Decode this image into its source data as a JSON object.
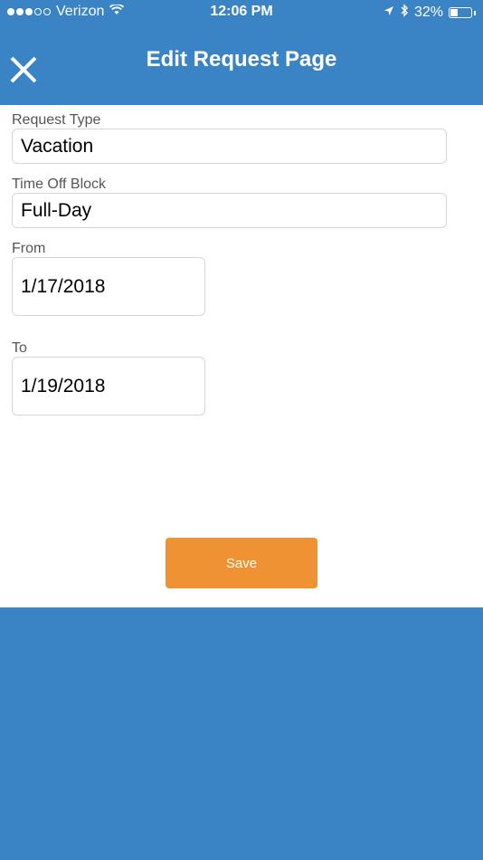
{
  "status_bar": {
    "carrier": "Verizon",
    "time": "12:06 PM",
    "battery_percent": "32%",
    "battery_level": 0.32,
    "icons": [
      "signal-dots-icon",
      "wifi-icon",
      "location-arrow-icon",
      "bluetooth-icon",
      "battery-icon"
    ]
  },
  "header": {
    "title": "Edit Request Page",
    "close_icon": "close-icon"
  },
  "form": {
    "request_type": {
      "label": "Request Type",
      "value": "Vacation"
    },
    "time_off_block": {
      "label": "Time Off Block",
      "value": "Full-Day"
    },
    "from": {
      "label": "From",
      "value": "1/17/2018"
    },
    "to": {
      "label": "To",
      "value": "1/19/2018"
    },
    "save_label": "Save"
  },
  "colors": {
    "brand_blue": "#3a84c5",
    "save_orange": "#ee9234",
    "white": "#ffffff"
  }
}
